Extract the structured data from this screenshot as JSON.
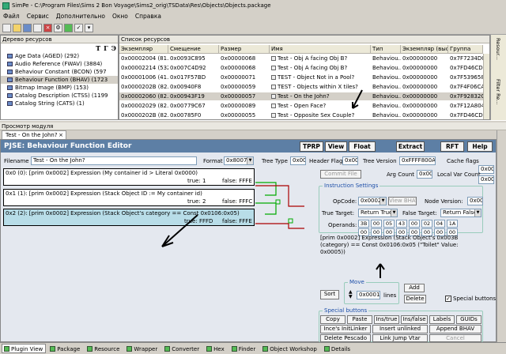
{
  "window": {
    "title": "SimPe - C:\\Program Files\\Sims 2 Bon Voyage\\Sims2_orig\\TSData\\Res\\Objects\\Objects.package"
  },
  "menu": {
    "items": [
      "Файл",
      "Сервис",
      "Дополнительно",
      "Окно",
      "Справка"
    ]
  },
  "resource_tree": {
    "header": "Дерево ресурсов",
    "icons": [
      "T",
      "Г",
      "Э"
    ],
    "items": [
      "Age Data (AGED) (292)",
      "Audio Reference (FWAV) (3884)",
      "Behaviour Constant (BCON) (597",
      "Behaviour Function (BHAV) (1723",
      "Bitmap Image (BMP) (153)",
      "Catalog Description (CTSS) (1199",
      "Catalog String (CATS) (1)"
    ]
  },
  "resource_list": {
    "header": "Список ресурсов",
    "columns": [
      "Экземпляр",
      "Смещение",
      "Размер",
      "Имя",
      "Тип",
      "Экземпляр (выс)",
      "Группа"
    ],
    "rows": [
      [
        "0x00002004 (81...",
        "0x0093C895",
        "0x00000068",
        "Test - Obj A facing Obj B?",
        "Behaviou...",
        "0x00000000",
        "0x7F7234D0"
      ],
      [
        "0x00002214 (532...",
        "0x007C4D92",
        "0x00000068",
        "Test - Obj A facing Obj B?",
        "Behaviou...",
        "0x00000000",
        "0x7FD46CD0"
      ],
      [
        "0x00001006 (41...",
        "0x017F57BD",
        "0x00000071",
        "TEST - Object Not in a Pool?",
        "Behaviou...",
        "0x00000000",
        "0x7F539658"
      ],
      [
        "0x0000202B (82...",
        "0x00940F8",
        "0x00000059",
        "TEST - Objects within X tiles?",
        "Behaviou...",
        "0x00000000",
        "0x7F4F06CA"
      ],
      [
        "0x00002060 (82...",
        "0x00943F19",
        "0x00000057",
        "Test - On the John?",
        "Behaviou...",
        "0x00000000",
        "0x7F92832C"
      ],
      [
        "0x00002029 (82...",
        "0x00779C67",
        "0x00000089",
        "Test - Open Face?",
        "Behaviou...",
        "0x00000000",
        "0x7F12A804"
      ],
      [
        "0x0000202B (82...",
        "0x00785F0",
        "0x00000055",
        "Test - Opposite Sex Couple?",
        "Behaviou...",
        "0x00000000",
        "0x7FD46CD0"
      ]
    ]
  },
  "right_dock": {
    "items": [
      "Resour...",
      "Filter Re..."
    ]
  },
  "preview": {
    "header": "Просмотр модуля",
    "tab_label": "Test - On the John?",
    "tab_close": "×"
  },
  "editor": {
    "title": "PJSE: Behaviour Function Editor",
    "buttons": [
      "TPRP",
      "View",
      "Float",
      "Extract",
      "RFT",
      "Help"
    ],
    "filename_label": "Filename",
    "filename_value": "Test - On the John?",
    "format_label": "Format",
    "format_value": "0x8007",
    "tree_type_label": "Tree Type",
    "tree_type_value": "0x00",
    "header_flag_label": "Header Flag",
    "header_flag_value": "0x00",
    "tree_version_label": "Tree Version",
    "tree_version_value": "0xFFFF800A",
    "cache_flags_label": "Cache flags",
    "cache_flags_value": "0x00",
    "commit_label": "Commit File",
    "arg_count_label": "Arg Count",
    "arg_count_value": "0x00",
    "local_var_label": "Local Var Count",
    "local_var_value": "0x00"
  },
  "instructions": [
    {
      "line": "0x0 (0): [prim 0x0002] Expression (My container id > Literal 0x0000)",
      "true_label": "true: 1",
      "false_label": "false: FFFE"
    },
    {
      "line": "0x1 (1): [prim 0x0002] Expression (Stack Object ID := My container id)",
      "true_label": "true: 2",
      "false_label": "false: FFFC"
    },
    {
      "line": "0x2 (2): [prim 0x0002] Expression (Stack Object's category == Const 0x0106:0x05)",
      "true_label": "true: FFFD",
      "false_label": "false: FFFE"
    }
  ],
  "instruction_settings": {
    "title": "Instruction Settings",
    "opcode_label": "OpCode:",
    "opcode_value": "0x0002",
    "view_bhav_label": "View BHAV",
    "node_version_label": "Node Version:",
    "node_version_value": "0x00",
    "true_target_label": "True Target:",
    "true_target_value": "Return True",
    "false_target_label": "False Target:",
    "false_target_value": "Return False",
    "operands_label": "Operands:",
    "operands_row1": [
      "3B",
      "00",
      "05",
      "43",
      "00",
      "02",
      "04",
      "1A"
    ],
    "operands_row2": [
      "00",
      "00",
      "00",
      "00",
      "00",
      "00",
      "00",
      "00"
    ],
    "description": "[prim 0x0002] Expression (Stack Object's 0x003B (category) == Const 0x0106:0x05 (\"Toilet\" Value: 0x0005))"
  },
  "move": {
    "title": "Move",
    "sort_label": "Sort",
    "value": "0x0001",
    "lines_label": "lines",
    "add_label": "Add",
    "delete_label": "Delete",
    "special_buttons_label": "Special buttons",
    "special_checked": "✓"
  },
  "special_buttons": {
    "title": "Special buttons",
    "row1": [
      "Copy",
      "Paste",
      "Ins/true",
      "Ins/false",
      "Labels",
      "GUIDs"
    ],
    "row2": [
      "Ince's InitLinker",
      "Insert unlinked",
      "Append BHAV"
    ],
    "row3": [
      "Delete Pescado",
      "Link Jump Vtar",
      "Cancel"
    ]
  },
  "bottom_tabs": [
    "Plugin View",
    "Package",
    "Resource",
    "Wrapper",
    "Converter",
    "Hex",
    "Finder",
    "Object Workshop",
    "Details"
  ],
  "colors": {
    "title_bar": "#5d7fa5",
    "selected_instruction": "#b8dde8",
    "link_true": "#00aa00",
    "link_false": "#aa0000"
  }
}
